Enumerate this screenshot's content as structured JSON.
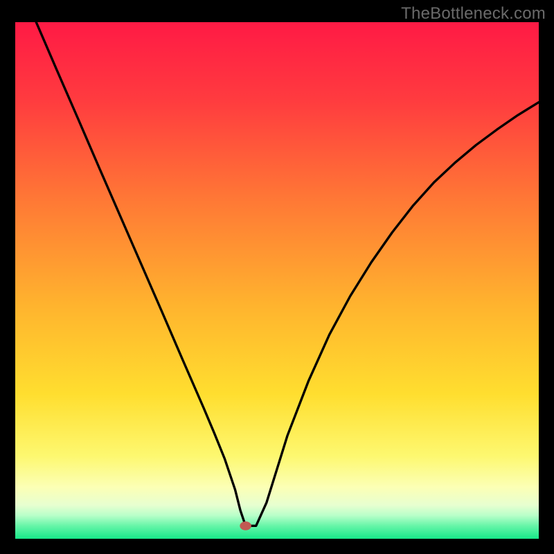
{
  "watermark": "TheBottleneck.com",
  "chart_data": {
    "type": "line",
    "title": "",
    "xlabel": "",
    "ylabel": "",
    "xlim": [
      0,
      100
    ],
    "ylim": [
      0,
      100
    ],
    "grid": false,
    "legend": false,
    "series": [
      {
        "name": "bottleneck-curve",
        "color": "#000000",
        "x": [
          4,
          8,
          12,
          16,
          20,
          24,
          28,
          32,
          36,
          38,
          40,
          41,
          42,
          43,
          44,
          46,
          48,
          52,
          56,
          60,
          64,
          68,
          72,
          76,
          80,
          84,
          88,
          92,
          96,
          100
        ],
        "values": [
          100,
          90.6,
          81.3,
          71.9,
          62.6,
          53.3,
          44.0,
          34.6,
          25.3,
          20.5,
          15.5,
          12.5,
          9.5,
          5.5,
          2.5,
          2.5,
          7.0,
          20.0,
          30.5,
          39.5,
          47.0,
          53.5,
          59.3,
          64.5,
          69.0,
          72.8,
          76.2,
          79.2,
          82.0,
          84.5
        ]
      }
    ],
    "marker": {
      "x": 44.0,
      "y": 2.5,
      "color": "#c15a52"
    },
    "gradient_stops": [
      {
        "offset": 0.0,
        "color": "#ff1a45"
      },
      {
        "offset": 0.15,
        "color": "#ff3b3f"
      },
      {
        "offset": 0.35,
        "color": "#ff7a35"
      },
      {
        "offset": 0.55,
        "color": "#ffb42e"
      },
      {
        "offset": 0.72,
        "color": "#ffde2f"
      },
      {
        "offset": 0.84,
        "color": "#fdf870"
      },
      {
        "offset": 0.9,
        "color": "#fcffb5"
      },
      {
        "offset": 0.935,
        "color": "#e7ffd0"
      },
      {
        "offset": 0.955,
        "color": "#b8ffc9"
      },
      {
        "offset": 0.975,
        "color": "#66f5a8"
      },
      {
        "offset": 1.0,
        "color": "#17e889"
      }
    ]
  }
}
